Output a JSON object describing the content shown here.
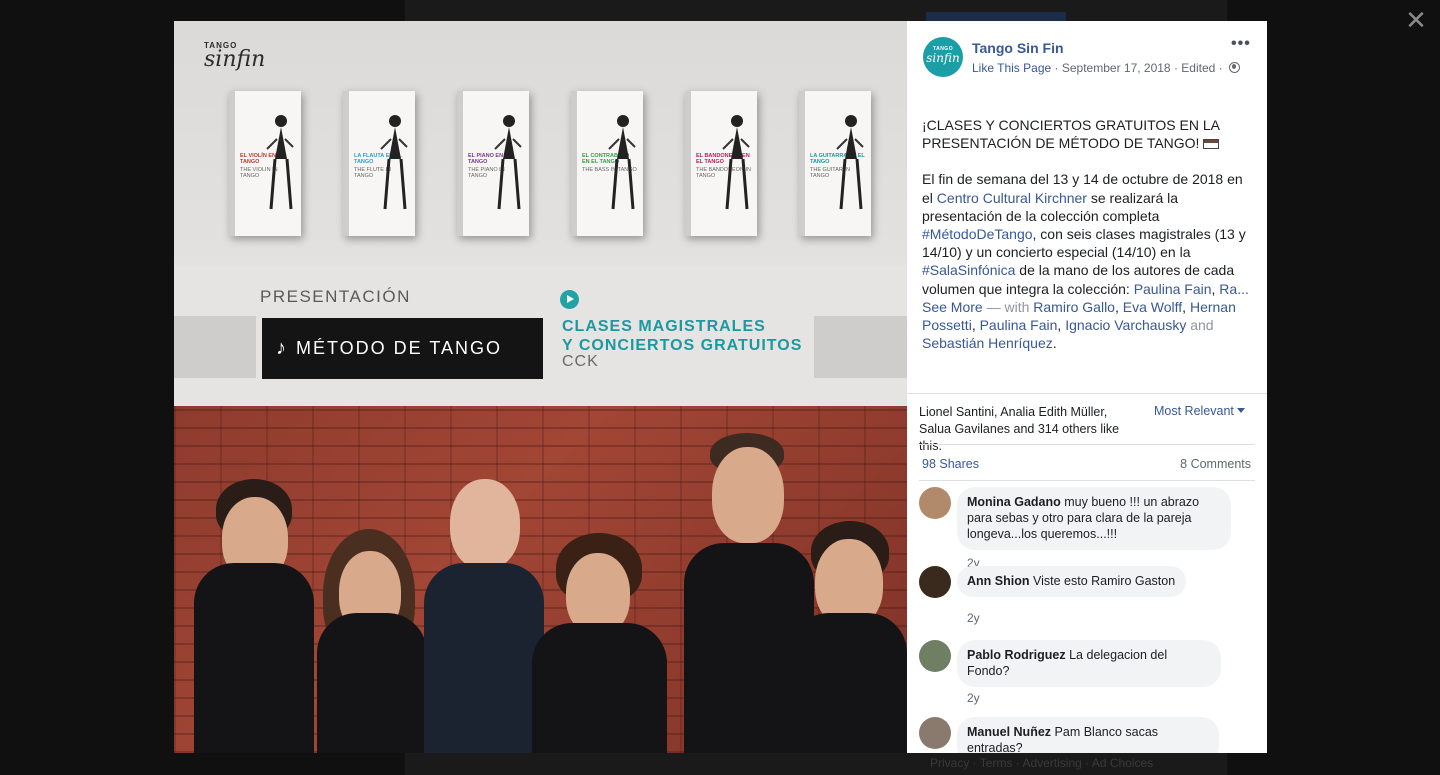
{
  "backdrop": {
    "footer_text": "Privacy · Terms · Advertising · Ad Choices"
  },
  "close_icon": "close-icon",
  "photo": {
    "brand_small": "TANGO",
    "brand_large": "sinfin",
    "books": [
      {
        "title": "EL VIOLÍN EN EL TANGO",
        "sub": "THE VIOLIN IN TANGO",
        "color": "#c0392b"
      },
      {
        "title": "LA FLAUTA EN EL TANGO",
        "sub": "THE FLUTE IN TANGO",
        "color": "#2a9fd6"
      },
      {
        "title": "EL PIANO EN EL TANGO",
        "sub": "THE PIANO IN TANGO",
        "color": "#7a3b8f"
      },
      {
        "title": "EL CONTRABAJO EN EL TANGO",
        "sub": "THE BASS IN TANGO",
        "color": "#2f9e44"
      },
      {
        "title": "EL BANDONEÓN EN EL TANGO",
        "sub": "THE BANDONEON IN TANGO",
        "color": "#c2185b"
      },
      {
        "title": "LA GUITARRA EN EL TANGO",
        "sub": "THE GUITAR IN TANGO",
        "color": "#1a9aa0"
      }
    ],
    "presentacion": "PRESENTACIÓN",
    "metodo_note": "♪",
    "metodo": "MÉTODO DE TANGO",
    "clases_line1": "CLASES MAGISTRALES",
    "clases_line2": "Y CONCIERTOS GRATUITOS",
    "cck": "CCK"
  },
  "post": {
    "page_name": "Tango Sin Fin",
    "avatar_small": "TANGO",
    "avatar_large": "sinfin",
    "like_page": "Like This Page",
    "date": "September 17, 2018",
    "edited": "Edited",
    "more_icon": "•••",
    "headline": "¡CLASES Y CONCIERTOS GRATUITOS EN LA PRESENTACIÓN DE MÉTODO DE TANGO!",
    "body_1": "El fin de semana del 13 y 14 de octubre de 2018 en el ",
    "link_centro": "Centro Cultural Kirchner",
    "body_2": " se realizará la presentación de la colección completa ",
    "hashtag_metodo": "#MétodoDeTango",
    "body_3": ", con seis clases magistrales (13 y 14/10) y un concierto especial (14/10) en la ",
    "hashtag_sala": "#SalaSinfónica",
    "body_4": " de la mano de los autores de cada volumen que integra la colección: ",
    "link_paulina": "Paulina Fain",
    "body_5": ", ",
    "ra_see_more": "Ra... See More",
    "with_text": " — with ",
    "tag_ramiro": "Ramiro Gallo",
    "tag_eva": "Eva Wolff",
    "tag_hernan": "Hernan Possetti",
    "tag_paulina": "Paulina Fain",
    "tag_ignacio": "Ignacio Varchausky",
    "and_text": " and ",
    "tag_sebastian": "Sebastián Henríquez",
    "comma": ", ",
    "period": "."
  },
  "reactions": {
    "likes_text": "Lionel Santini, Analia Edith Müller, Salua Gavilanes and 314 others like this.",
    "most_relevant": "Most Relevant",
    "shares": "98 Shares",
    "comments": "8 Comments"
  },
  "comments": [
    {
      "name": "Monina Gadano",
      "text": "muy bueno !!! un abrazo para sebas y otro para clara de la pareja longeva...los queremos...!!!",
      "time": "2y",
      "avatar_color": "#b08a6a"
    },
    {
      "name": "Ann Shion",
      "text": "Viste esto Ramiro Gaston",
      "time": "2y",
      "avatar_color": "#3a2a1e"
    },
    {
      "name": "Pablo Rodriguez",
      "text": "La delegacion del Fondo?",
      "time": "2y",
      "avatar_color": "#6f7f64"
    },
    {
      "name": "Manuel Nuñez",
      "text": "Pam Blanco sacas entradas?",
      "time": "",
      "avatar_color": "#8a7a6e"
    }
  ]
}
